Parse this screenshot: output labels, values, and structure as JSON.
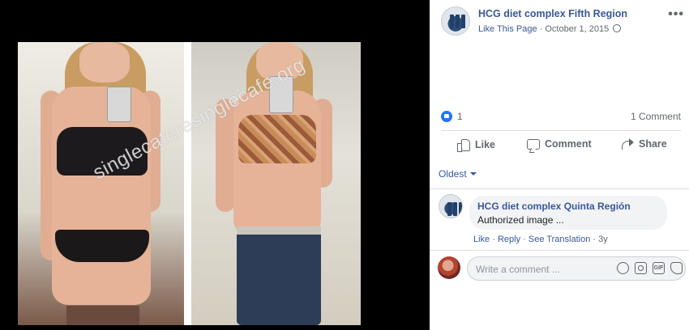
{
  "photo": {
    "watermark": "singlecateresinglecafe.org"
  },
  "post": {
    "page_name": "HCG diet complex Fifth Region",
    "like_page": "Like This Page",
    "separator": " · ",
    "date": "October 1, 2015",
    "more_icon": "more-horizontal-icon",
    "privacy_icon": "globe-icon"
  },
  "reactions": {
    "like_count": "1",
    "comment_count": "1 Comment"
  },
  "actions": {
    "like": "Like",
    "comment": "Comment",
    "share": "Share"
  },
  "comments": {
    "sort_label": "Oldest",
    "items": [
      {
        "author": "HCG diet complex Quinta Región",
        "text": "Authorized image ...",
        "actions": {
          "like": "Like",
          "reply": "Reply",
          "see_translation": "See Translation",
          "age": "3y"
        }
      }
    ]
  },
  "composer": {
    "placeholder": "Write a comment ..."
  },
  "colors": {
    "link": "#385898",
    "like_blue": "#2078f4",
    "secondary_text": "#606770",
    "divider": "#dadde1"
  }
}
